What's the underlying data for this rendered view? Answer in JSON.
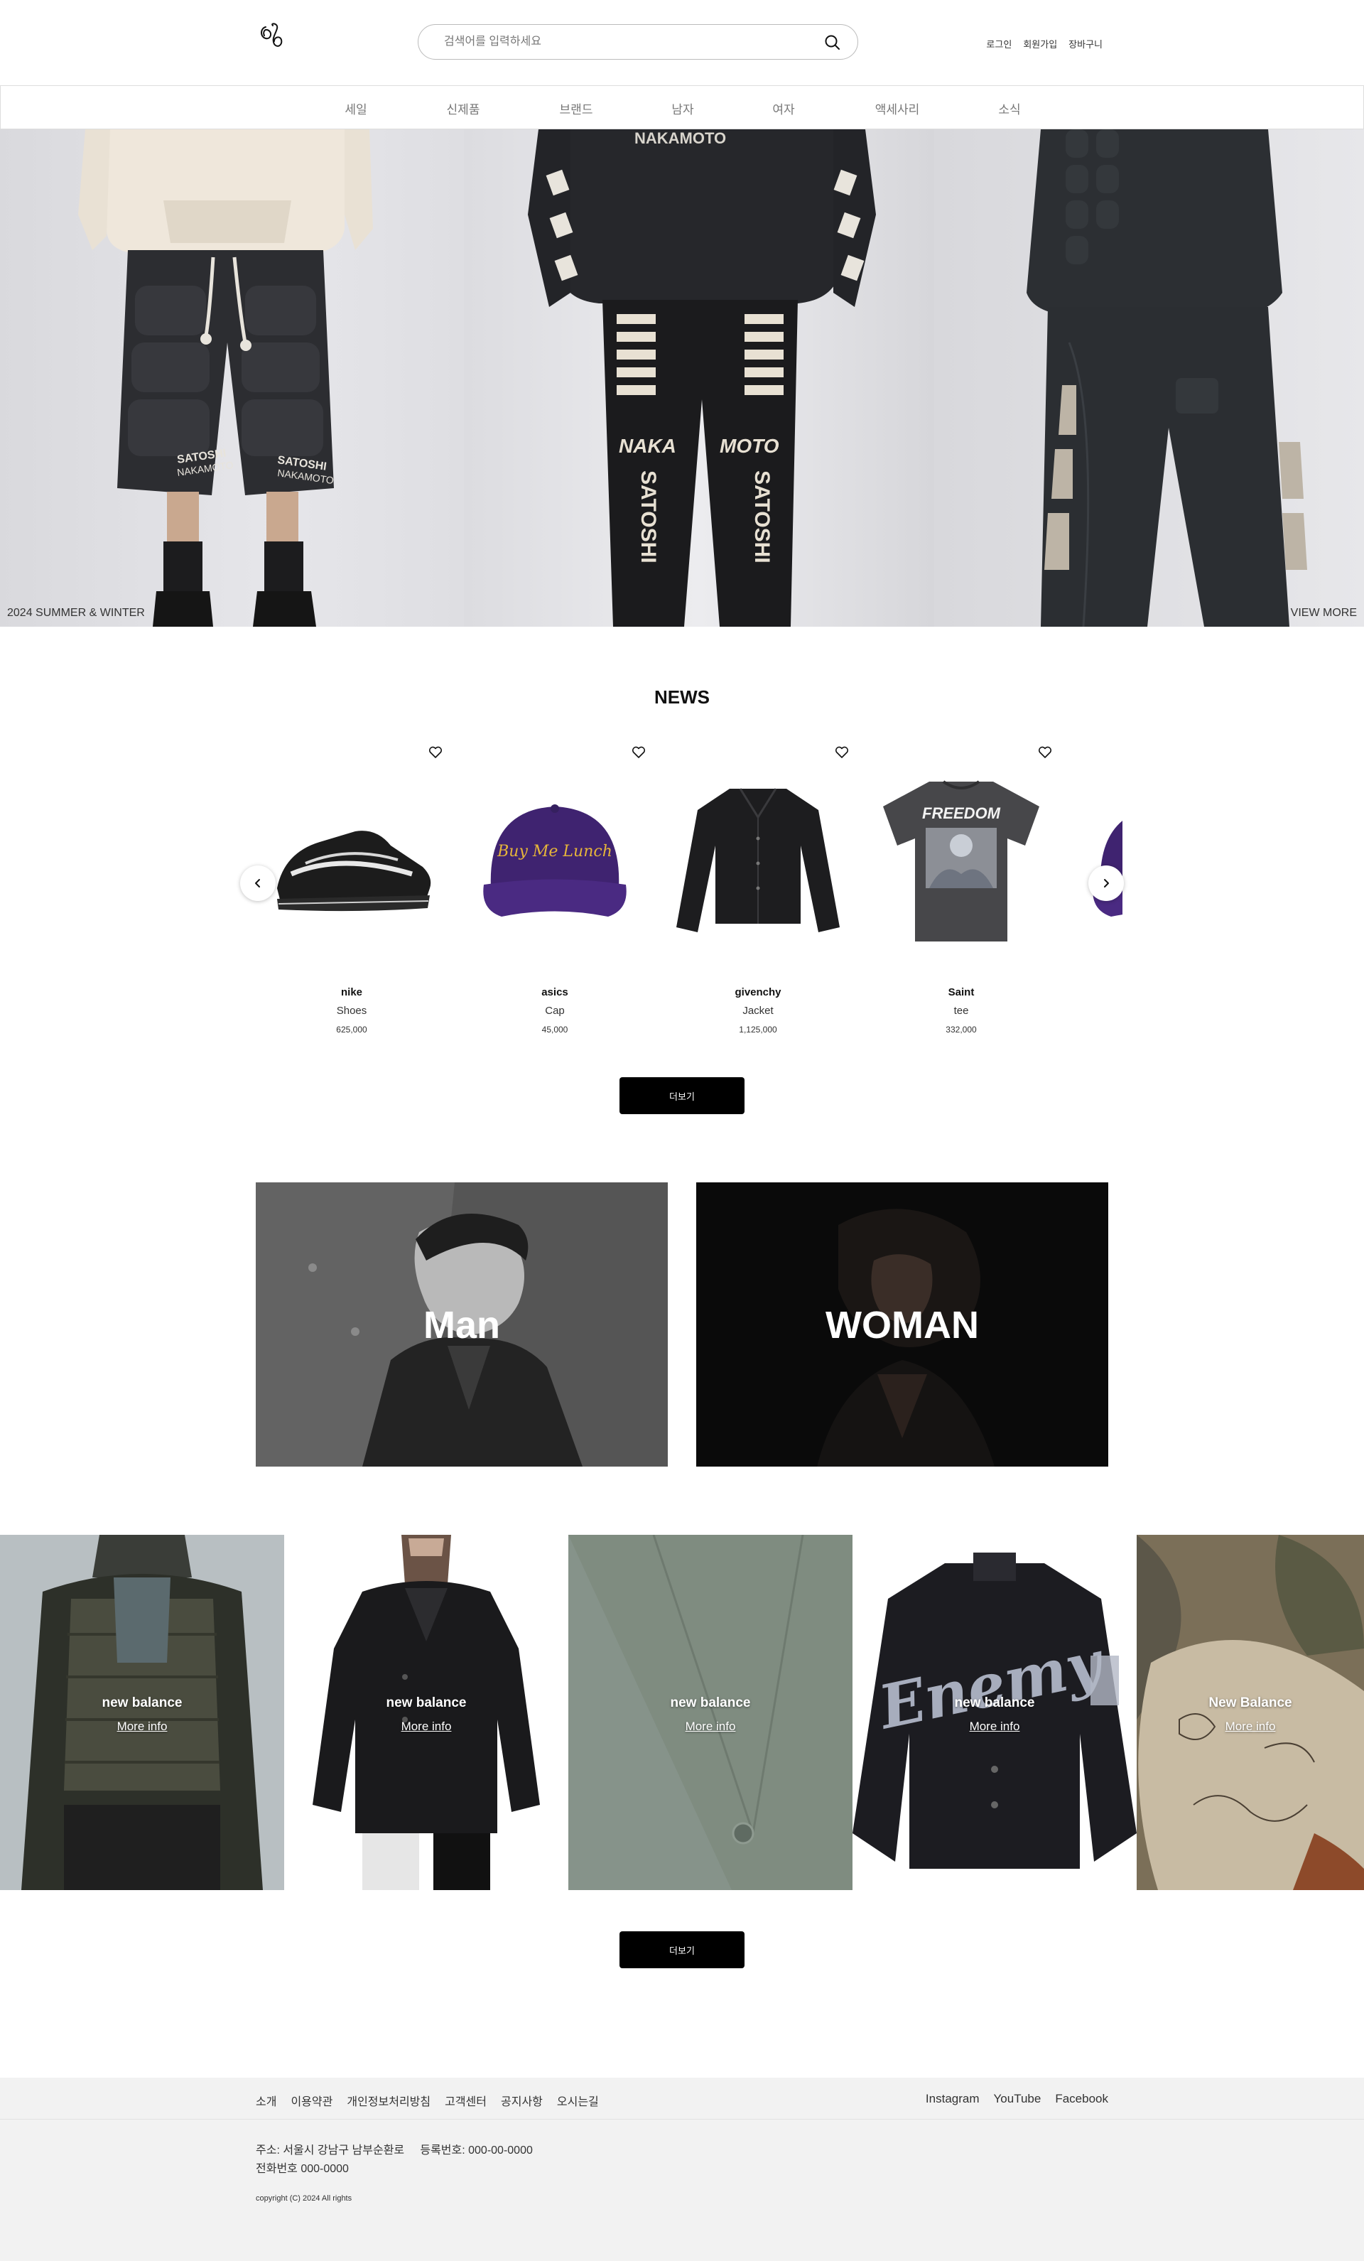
{
  "header": {
    "search_placeholder": "검색어를 입력하세요",
    "util_links": [
      "로그인",
      "회원가입",
      "장바구니"
    ]
  },
  "nav": {
    "items": [
      "세일",
      "신제품",
      "브랜드",
      "남자",
      "여자",
      "액세사리",
      "소식"
    ]
  },
  "hero": {
    "caption": "2024 SUMMER & WINTER",
    "view_more": "VIEW MORE",
    "print_text": [
      "SATOSHI",
      "NAKAMOTO",
      "NAKA",
      "MOTO",
      "SATOSHI"
    ]
  },
  "news": {
    "title": "NEWS",
    "products": [
      {
        "brand": "nike",
        "type": "Shoes",
        "price": "625,000",
        "image": "sneaker"
      },
      {
        "brand": "asics",
        "type": "Cap",
        "price": "45,000",
        "image": "cap",
        "print": "Buy Me Lunch"
      },
      {
        "brand": "givenchy",
        "type": "Jacket",
        "price": "1,125,000",
        "image": "jacket"
      },
      {
        "brand": "Saint",
        "type": "tee",
        "price": "332,000",
        "image": "tee",
        "print": "FREEDOM"
      }
    ],
    "more_label": "더보기"
  },
  "categories": {
    "man": "Man",
    "woman": "WOMAN"
  },
  "tiles": {
    "items": [
      {
        "title": "new balance",
        "link": "More info"
      },
      {
        "title": "new balance",
        "link": "More info"
      },
      {
        "title": "new balance",
        "link": "More info"
      },
      {
        "title": "new balance",
        "link": "More info",
        "print": "Enemy"
      },
      {
        "title": "New Balance",
        "link": "More info"
      }
    ],
    "more_label": "더보기"
  },
  "footer": {
    "links": [
      "소개",
      "이용약관",
      "개인정보처리방침",
      "고객센터",
      "공지사항",
      "오시는길"
    ],
    "social": [
      "Instagram",
      "YouTube",
      "Facebook"
    ],
    "address": "주소: 서울시 강남구 남부순환로     등록번호: 000-00-0000",
    "phone": "전화번호 000-0000",
    "copyright": "copyright (C) 2024 All rights"
  }
}
